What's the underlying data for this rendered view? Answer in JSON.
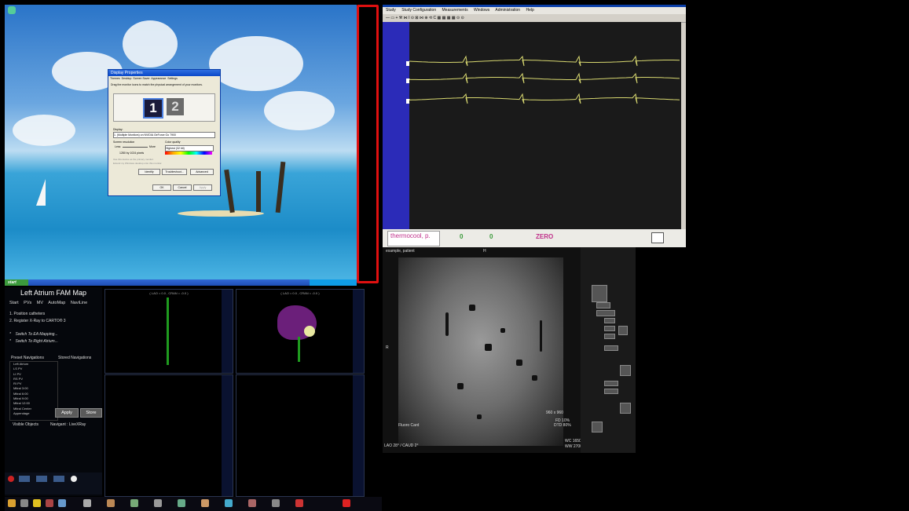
{
  "desktop": {
    "start_label": "start",
    "dialog": {
      "title": "Display Properties",
      "tabs": [
        "Themes",
        "Desktop",
        "Screen Saver",
        "Appearance",
        "Settings"
      ],
      "hint": "Drag the monitor icons to match the physical arrangement of your monitors.",
      "monitor1": "1",
      "monitor2": "2",
      "display_label": "Display:",
      "display_value": "1. (Multiple Monitors) on NVIDIA GeForce Go 7900",
      "resolution_label": "Screen resolution",
      "less_label": "Less",
      "more_label": "More",
      "resolution_value": "1280 by 1024 pixels",
      "color_label": "Color quality",
      "color_value": "Highest (32 bit)",
      "opt1": "Use this device as the primary monitor.",
      "opt2": "Extend my Windows desktop onto this monitor.",
      "identify": "Identify",
      "troubleshoot": "Troubleshoot...",
      "advanced": "Advanced",
      "ok": "OK",
      "cancel": "Cancel",
      "apply": "Apply"
    }
  },
  "ecg": {
    "menu": [
      "Study",
      "Study Configuration",
      "Measurements",
      "Windows",
      "Administration",
      "Help"
    ],
    "catheter": "thermocool, p.",
    "zero_label": "ZERO",
    "readings": [
      "0",
      "0"
    ],
    "trace_color": "#d8d870",
    "panel_color": "#2b2bb8"
  },
  "fluoro": {
    "patient": "example, patient",
    "corner_bottom_left": "LAO 28° / CAUD 2°",
    "fluoro_label": "Fluoro Card",
    "fd_label": "FD 10%",
    "dtd_label": "DTD 80%",
    "wc_label": "WC 1650",
    "ww_label": "WW 2700",
    "sizes": "960 x 960",
    "right_letter": "R",
    "top_letter": "H"
  },
  "carto": {
    "title": "Left Atrium FAM Map",
    "tabs": [
      "Start",
      "PVs",
      "MV",
      "AutoMap",
      "NaviLine"
    ],
    "steps": [
      "1.    Position catheters",
      "2.    Register X-Ray to CARTO® 3"
    ],
    "links": [
      "Switch To EA Mapping...",
      "Switch To Right Atrium..."
    ],
    "preset_label": "Preset Navigations",
    "stored_label": "Stored Navigations",
    "presets": [
      "Left Atrium",
      "LS PV",
      "LI PV",
      "RS PV",
      "RI PV",
      "Mitral 3:00",
      "Mitral 6:00",
      "Mitral 9:00",
      "Mitral 12:00",
      "Mitral Center",
      "Appendage"
    ],
    "apply": "Apply",
    "store": "Store",
    "visible_objects": "Visible Objects",
    "navigant": "Navigant : LiveXRay",
    "view_header": "( LAO = 0.0 , CRAN = -0.0 )",
    "map_color": "#6b1f7a",
    "catheter_color": "#1f9a1f"
  }
}
